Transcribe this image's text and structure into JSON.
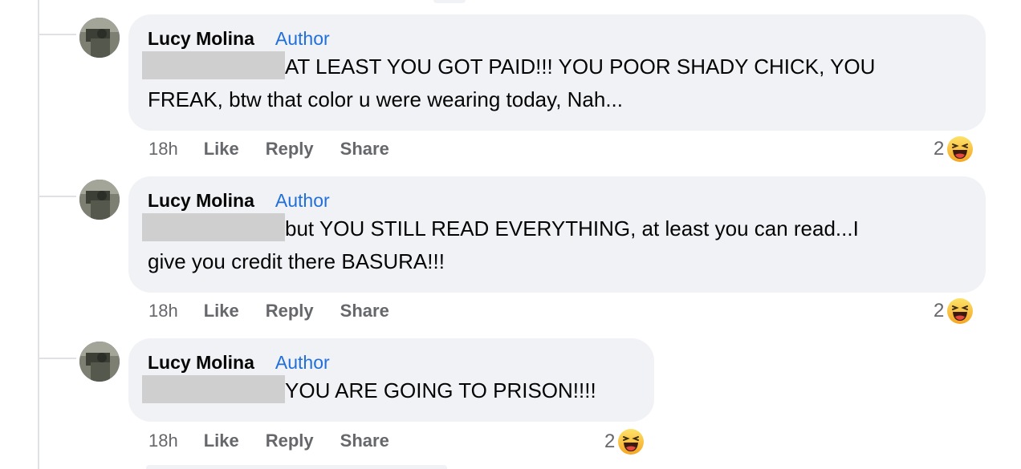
{
  "comments": [
    {
      "author": "Lucy Molina",
      "badge": "Author",
      "text_line1": "AT LEAST YOU GOT PAID!!! YOU POOR SHADY CHICK, YOU",
      "text_line2": "FREAK, btw that color u were wearing today, Nah...",
      "time": "18h",
      "like": "Like",
      "reply": "Reply",
      "share": "Share",
      "reaction_count": "2",
      "reaction_icon": "haha-emoji-icon"
    },
    {
      "author": "Lucy Molina",
      "badge": "Author",
      "text_line1": "but YOU STILL READ EVERYTHING, at least you can read...I",
      "text_line2": "give you credit there BASURA!!!",
      "time": "18h",
      "like": "Like",
      "reply": "Reply",
      "share": "Share",
      "reaction_count": "2",
      "reaction_icon": "haha-emoji-icon"
    },
    {
      "author": "Lucy Molina",
      "badge": "Author",
      "text_line1": "YOU ARE GOING TO PRISON!!!!",
      "time": "18h",
      "like": "Like",
      "reply": "Reply",
      "share": "Share",
      "reaction_count": "2",
      "reaction_icon": "haha-emoji-icon"
    }
  ],
  "colors": {
    "bubble": "#f0f2f5",
    "author_badge": "#216fdb",
    "meta_text": "#65676b",
    "redaction": "#cfcfcf"
  }
}
